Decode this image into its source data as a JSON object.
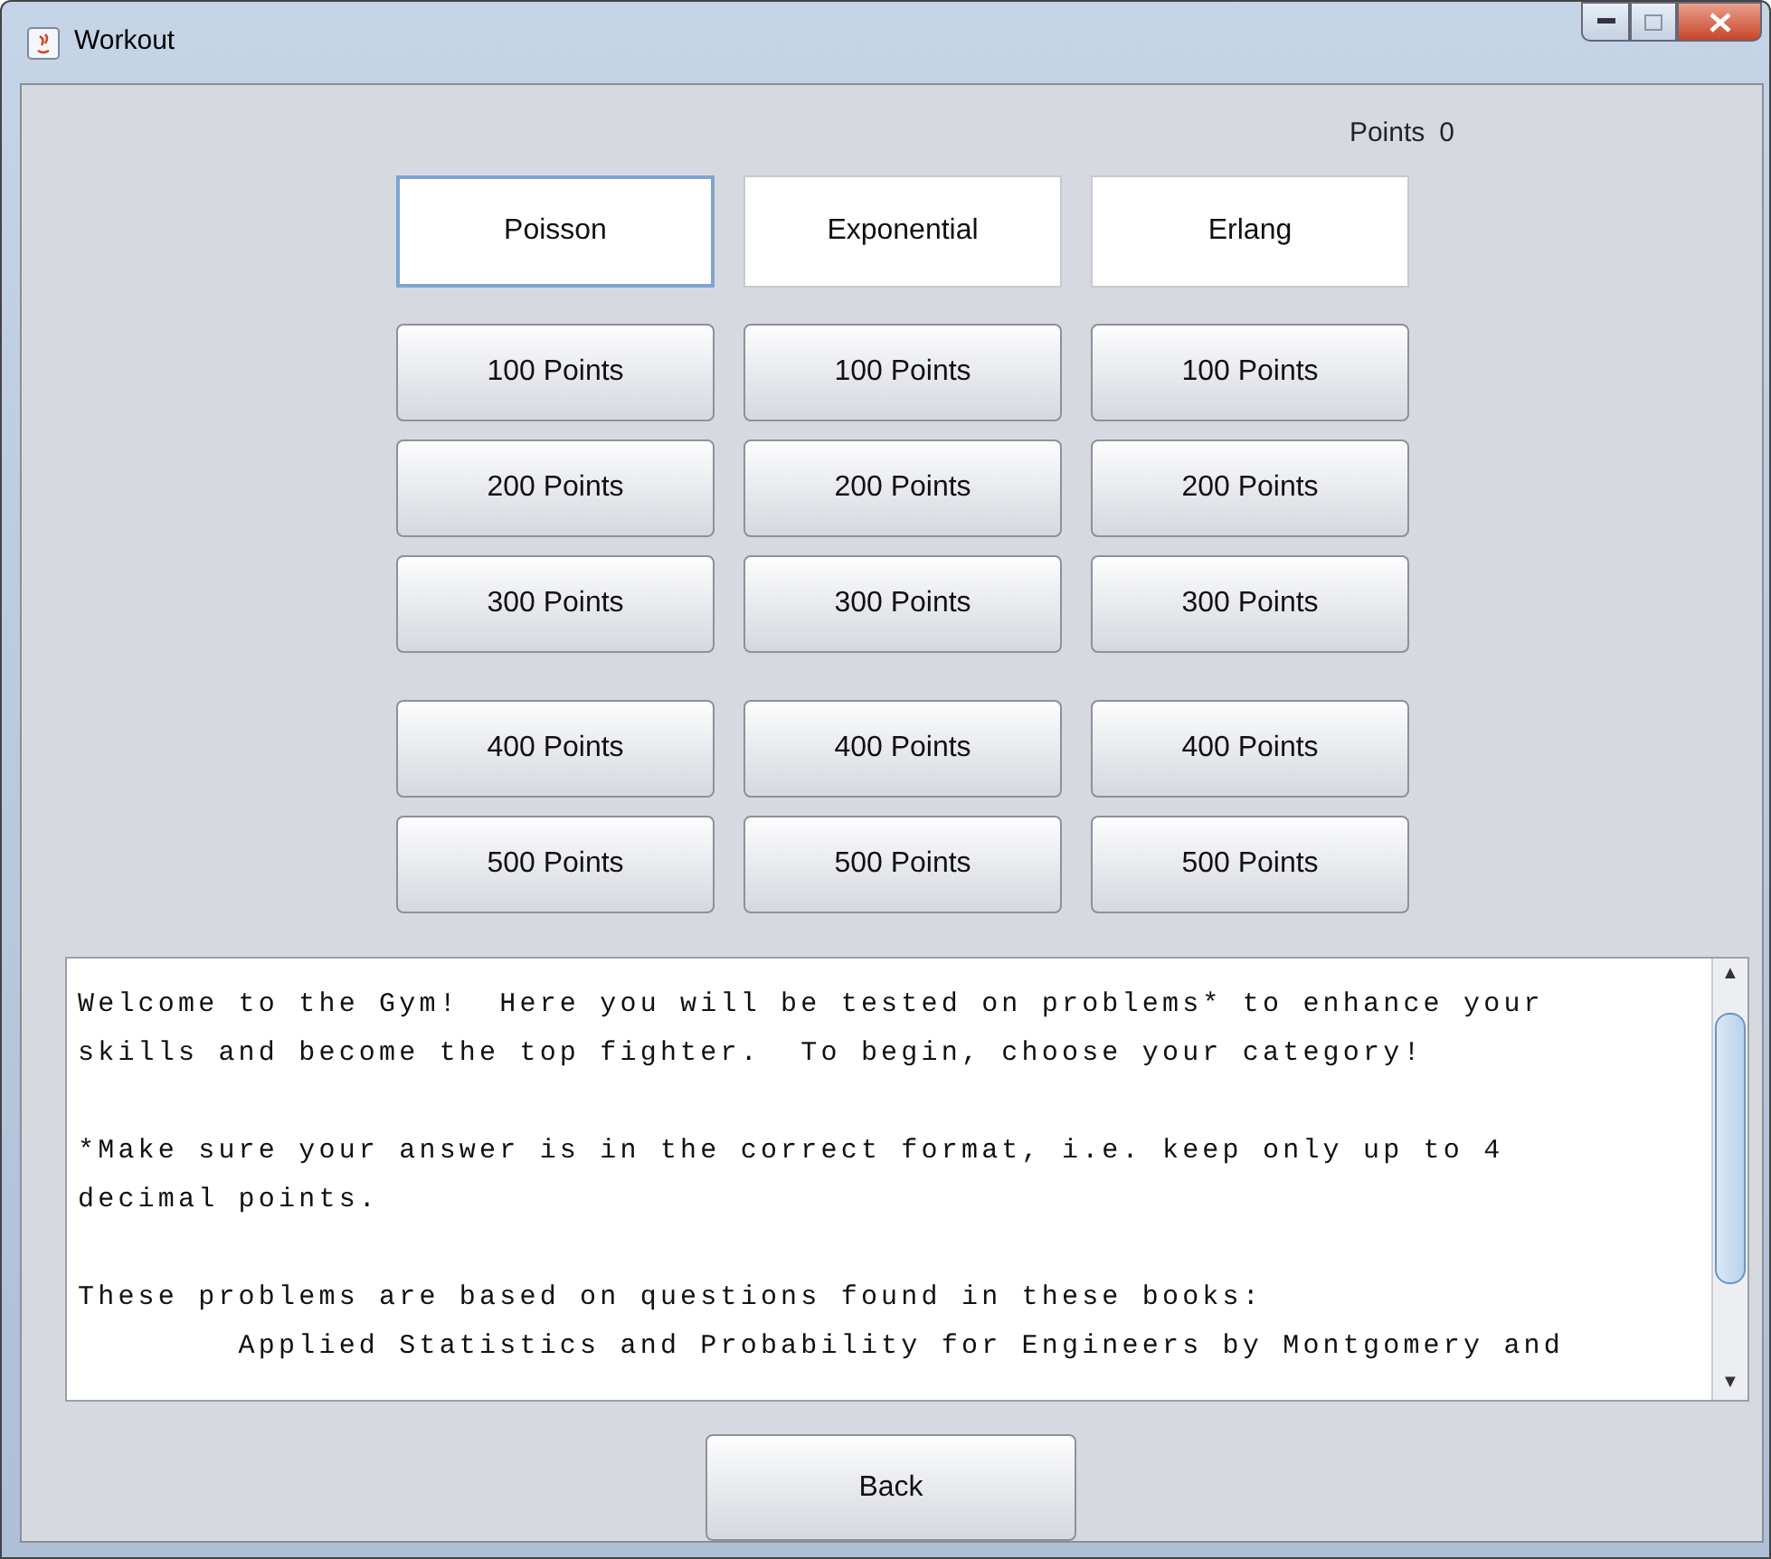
{
  "window": {
    "title": "Workout"
  },
  "points": {
    "label": "Points",
    "value": "0"
  },
  "categories": [
    {
      "label": "Poisson",
      "selected": true
    },
    {
      "label": "Exponential",
      "selected": false
    },
    {
      "label": "Erlang",
      "selected": false
    }
  ],
  "point_rows": [
    [
      "100 Points",
      "100 Points",
      "100 Points"
    ],
    [
      "200 Points",
      "200 Points",
      "200 Points"
    ],
    [
      "300 Points",
      "300 Points",
      "300 Points"
    ],
    [
      "400 Points",
      "400 Points",
      "400 Points"
    ],
    [
      "500 Points",
      "500 Points",
      "500 Points"
    ]
  ],
  "message_paragraphs": [
    [
      "Welcome to the Gym!  Here you will be tested on problems* to enhance your",
      "skills and become the top fighter.  To begin, choose your category!"
    ],
    [
      "*Make sure your answer is in the correct format, i.e. keep only up to 4",
      "decimal points."
    ],
    [
      "These problems are based on questions found in these books:",
      "        Applied Statistics and Probability for Engineers by Montgomery and"
    ]
  ],
  "scroll_buttons": [
    "▲",
    "▼"
  ],
  "back_button": "Back"
}
